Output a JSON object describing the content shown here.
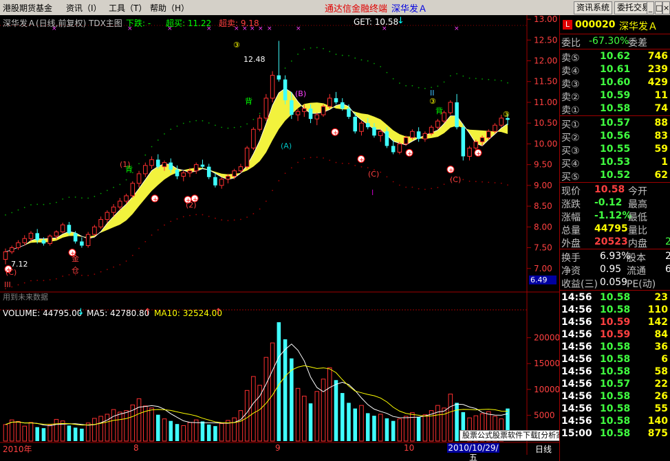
{
  "menubar": {
    "items": [
      "港股期货基金",
      "资讯（I）",
      "工具（T）",
      "帮助（H）"
    ],
    "title": "通达信金融终端",
    "stock": "深华发Ａ",
    "buttons": [
      "资讯系统",
      "委托交易"
    ],
    "win_controls": [
      "_",
      "□",
      "×"
    ]
  },
  "main_chart": {
    "header": {
      "name": "深华发Ａ(日线,前复权) TDX主图",
      "down_label": "下跌: -",
      "overbuy": "超买: 11.22",
      "oversell": "超卖: 9.18",
      "get": "GET: 10.58"
    },
    "price_axis": [
      "13.00",
      "12.50",
      "12.00",
      "11.50",
      "11.00",
      "10.50",
      "10.00",
      "9.50",
      "9.00",
      "8.50",
      "8.00",
      "7.50",
      "7.00"
    ],
    "current_price_tag": "6.49",
    "high_label": "12.48",
    "low_label": "7.12",
    "annotations": [
      "(C)",
      "III",
      "金",
      "仓",
      "(1)",
      "(2)",
      "(A)",
      "(B)",
      "(C)",
      "I",
      "(C)",
      "II",
      "背",
      "背",
      "背",
      "③",
      "③",
      "③"
    ],
    "future_note": "用到未来数据"
  },
  "volume_chart": {
    "header": {
      "volume": "VOLUME: 44795.00",
      "ma5": "MA5: 42780.80",
      "ma10": "MA10: 32524.00"
    },
    "axis": [
      "20000",
      "15000",
      "10000",
      "5000"
    ]
  },
  "date_axis": {
    "labels": [
      "2010年",
      "8",
      "9",
      "10"
    ],
    "cursor_date": "2010/10/29/五",
    "period": "日线"
  },
  "watermark": "股票公式股票软件下载[分析家公式网www.88gs.com]",
  "right_panel": {
    "code_prefix": "L",
    "code": "000020",
    "name": "深华发Ａ",
    "weibi_label": "委比",
    "weibi_value": "-67.30%",
    "weicha_label": "委差",
    "sell": [
      {
        "label": "卖⑤",
        "price": "10.62",
        "vol": "746"
      },
      {
        "label": "卖④",
        "price": "10.61",
        "vol": "239"
      },
      {
        "label": "卖③",
        "price": "10.60",
        "vol": "429"
      },
      {
        "label": "卖②",
        "price": "10.59",
        "vol": "11"
      },
      {
        "label": "卖①",
        "price": "10.58",
        "vol": "74"
      }
    ],
    "buy": [
      {
        "label": "买①",
        "price": "10.57",
        "vol": "88"
      },
      {
        "label": "买②",
        "price": "10.56",
        "vol": "83"
      },
      {
        "label": "买③",
        "price": "10.55",
        "vol": "59"
      },
      {
        "label": "买④",
        "price": "10.53",
        "vol": "1"
      },
      {
        "label": "买⑤",
        "price": "10.52",
        "vol": "62"
      }
    ],
    "quote": [
      {
        "l1": "现价",
        "v1": "10.58",
        "l2": "今开",
        "c": "#ff4040"
      },
      {
        "l1": "涨跌",
        "v1": "-0.12",
        "l2": "最高",
        "c": "#40ff40"
      },
      {
        "l1": "涨幅",
        "v1": "-1.12%",
        "l2": "最低",
        "c": "#40ff40"
      },
      {
        "l1": "总量",
        "v1": "44795",
        "l2": "量比",
        "c": "#ffff00"
      },
      {
        "l1": "外盘",
        "v1": "20523",
        "l2": "内盘",
        "c": "#ff4040"
      }
    ],
    "quote_tail": "2",
    "fund": [
      {
        "l1": "换手",
        "v1": "6.93%",
        "l2": "股本",
        "tail": "2"
      },
      {
        "l1": "净资",
        "v1": "0.95",
        "l2": "流通",
        "tail": "6"
      },
      {
        "l1": "收益(三)",
        "v1": "0.059",
        "l2": "PE(动)",
        "tail": ""
      }
    ],
    "ticks": [
      {
        "time": "14:56",
        "price": "10.58",
        "vol": "23"
      },
      {
        "time": "14:56",
        "price": "10.58",
        "vol": "110"
      },
      {
        "time": "14:56",
        "price": "10.59",
        "vol": "142"
      },
      {
        "time": "14:56",
        "price": "10.59",
        "vol": "84"
      },
      {
        "time": "14:56",
        "price": "10.58",
        "vol": "36"
      },
      {
        "time": "14:56",
        "price": "10.58",
        "vol": "6"
      },
      {
        "time": "14:56",
        "price": "10.58",
        "vol": "58"
      },
      {
        "time": "14:56",
        "price": "10.57",
        "vol": "22"
      },
      {
        "time": "14:56",
        "price": "10.58",
        "vol": "26"
      },
      {
        "time": "14:56",
        "price": "10.58",
        "vol": "55"
      },
      {
        "time": "14:56",
        "price": "10.58",
        "vol": "140"
      },
      {
        "time": "15:00",
        "price": "10.58",
        "vol": "875"
      }
    ]
  },
  "chart_data": {
    "type": "candlestick",
    "series_ohlc": [
      [
        7.22,
        7.48,
        7.1,
        7.4
      ],
      [
        7.4,
        7.55,
        7.35,
        7.5
      ],
      [
        7.5,
        7.68,
        7.45,
        7.62
      ],
      [
        7.62,
        7.8,
        7.55,
        7.72
      ],
      [
        7.72,
        7.9,
        7.65,
        7.85
      ],
      [
        7.85,
        7.95,
        7.6,
        7.68
      ],
      [
        7.68,
        7.75,
        7.55,
        7.6
      ],
      [
        7.6,
        7.82,
        7.55,
        7.78
      ],
      [
        7.78,
        7.92,
        7.7,
        7.88
      ],
      [
        7.88,
        8.1,
        7.85,
        8.05
      ],
      [
        8.05,
        8.12,
        7.8,
        7.85
      ],
      [
        7.85,
        7.9,
        7.6,
        7.65
      ],
      [
        7.65,
        7.75,
        7.5,
        7.55
      ],
      [
        7.55,
        7.88,
        7.5,
        7.82
      ],
      [
        7.82,
        8.05,
        7.78,
        8.0
      ],
      [
        8.0,
        8.25,
        7.95,
        8.18
      ],
      [
        8.18,
        8.4,
        8.1,
        8.35
      ],
      [
        8.35,
        8.55,
        8.25,
        8.48
      ],
      [
        8.48,
        8.7,
        8.4,
        8.62
      ],
      [
        8.62,
        8.8,
        8.55,
        8.75
      ],
      [
        8.75,
        9.1,
        8.7,
        9.05
      ],
      [
        9.05,
        9.35,
        8.95,
        9.28
      ],
      [
        9.28,
        9.55,
        9.2,
        9.48
      ],
      [
        9.48,
        9.7,
        9.4,
        9.62
      ],
      [
        9.62,
        9.75,
        9.4,
        9.45
      ],
      [
        9.45,
        9.6,
        9.35,
        9.55
      ],
      [
        9.55,
        9.65,
        9.3,
        9.38
      ],
      [
        9.38,
        9.48,
        9.15,
        9.22
      ],
      [
        9.22,
        9.35,
        9.1,
        9.3
      ],
      [
        9.3,
        9.42,
        9.2,
        9.35
      ],
      [
        9.35,
        9.55,
        9.28,
        9.5
      ],
      [
        9.5,
        9.62,
        9.4,
        9.45
      ],
      [
        9.45,
        9.52,
        9.15,
        9.2
      ],
      [
        9.2,
        9.3,
        8.95,
        9.0
      ],
      [
        9.0,
        9.2,
        8.92,
        9.15
      ],
      [
        9.15,
        9.28,
        9.05,
        9.22
      ],
      [
        9.22,
        9.4,
        9.15,
        9.35
      ],
      [
        9.35,
        9.52,
        9.3,
        9.45
      ],
      [
        9.45,
        9.95,
        9.4,
        9.9
      ],
      [
        9.9,
        10.4,
        9.85,
        10.35
      ],
      [
        10.35,
        10.7,
        10.3,
        10.62
      ],
      [
        10.62,
        11.2,
        10.55,
        11.1
      ],
      [
        11.1,
        11.75,
        11.0,
        11.65
      ],
      [
        11.65,
        12.48,
        11.5,
        11.55
      ],
      [
        11.55,
        11.65,
        10.95,
        11.05
      ],
      [
        11.05,
        11.25,
        10.6,
        10.7
      ],
      [
        10.7,
        10.85,
        10.55,
        10.78
      ],
      [
        10.78,
        10.95,
        10.65,
        10.85
      ],
      [
        10.85,
        10.95,
        10.5,
        10.6
      ],
      [
        10.6,
        10.75,
        10.45,
        10.7
      ],
      [
        10.7,
        10.95,
        10.65,
        10.9
      ],
      [
        10.9,
        11.2,
        10.85,
        11.1
      ],
      [
        11.1,
        11.25,
        10.95,
        11.0
      ],
      [
        11.0,
        11.1,
        10.8,
        10.85
      ],
      [
        10.85,
        10.95,
        10.6,
        10.65
      ],
      [
        10.65,
        10.75,
        10.25,
        10.3
      ],
      [
        10.3,
        10.55,
        10.2,
        10.5
      ],
      [
        10.5,
        10.62,
        10.35,
        10.4
      ],
      [
        10.4,
        10.5,
        10.15,
        10.2
      ],
      [
        10.2,
        10.35,
        10.05,
        10.3
      ],
      [
        10.3,
        10.4,
        9.9,
        9.95
      ],
      [
        9.95,
        10.1,
        9.75,
        9.8
      ],
      [
        9.8,
        10.05,
        9.75,
        10.0
      ],
      [
        10.0,
        10.2,
        9.95,
        10.15
      ],
      [
        10.15,
        10.35,
        10.1,
        10.3
      ],
      [
        10.3,
        10.4,
        10.05,
        10.12
      ],
      [
        10.12,
        10.3,
        10.05,
        10.25
      ],
      [
        10.25,
        10.45,
        10.2,
        10.4
      ],
      [
        10.4,
        10.6,
        10.35,
        10.55
      ],
      [
        10.55,
        10.8,
        10.5,
        10.75
      ],
      [
        10.75,
        11.05,
        10.7,
        11.0
      ],
      [
        11.0,
        11.2,
        10.35,
        10.4
      ],
      [
        10.4,
        10.48,
        9.6,
        9.7
      ],
      [
        9.7,
        9.95,
        9.6,
        9.9
      ],
      [
        9.9,
        10.1,
        9.85,
        10.05
      ],
      [
        10.05,
        10.2,
        9.95,
        10.15
      ],
      [
        10.15,
        10.35,
        10.1,
        10.3
      ],
      [
        10.3,
        10.5,
        10.25,
        10.45
      ],
      [
        10.45,
        10.7,
        10.4,
        10.62
      ],
      [
        10.62,
        10.72,
        10.45,
        10.58
      ]
    ],
    "volume": [
      3200,
      4100,
      3800,
      2900,
      3600,
      2700,
      2500,
      3100,
      4200,
      3900,
      3000,
      2600,
      2400,
      3500,
      4400,
      4800,
      5200,
      6100,
      5600,
      5900,
      7000,
      8200,
      6800,
      6400,
      5100,
      4300,
      3900,
      3300,
      3000,
      3600,
      4100,
      3800,
      3200,
      2900,
      3400,
      4000,
      4500,
      5900,
      9800,
      12500,
      10800,
      16200,
      19000,
      23000,
      19700,
      16000,
      10200,
      8700,
      7300,
      9600,
      12000,
      14200,
      11800,
      9300,
      7400,
      6300,
      6900,
      5400,
      4900,
      5200,
      4400,
      3900,
      4300,
      4800,
      5500,
      4700,
      5100,
      5900,
      6900,
      6400,
      9100,
      7400,
      5600,
      4500,
      4900,
      5300,
      5700,
      4800,
      4300,
      6300,
      4479
    ],
    "ma5_label": "MA5: 42780.80",
    "ma10_label": "MA10: 32524.00",
    "ylim": [
      6.45,
      13.1
    ],
    "vol_ylim": [
      0,
      25000
    ]
  }
}
